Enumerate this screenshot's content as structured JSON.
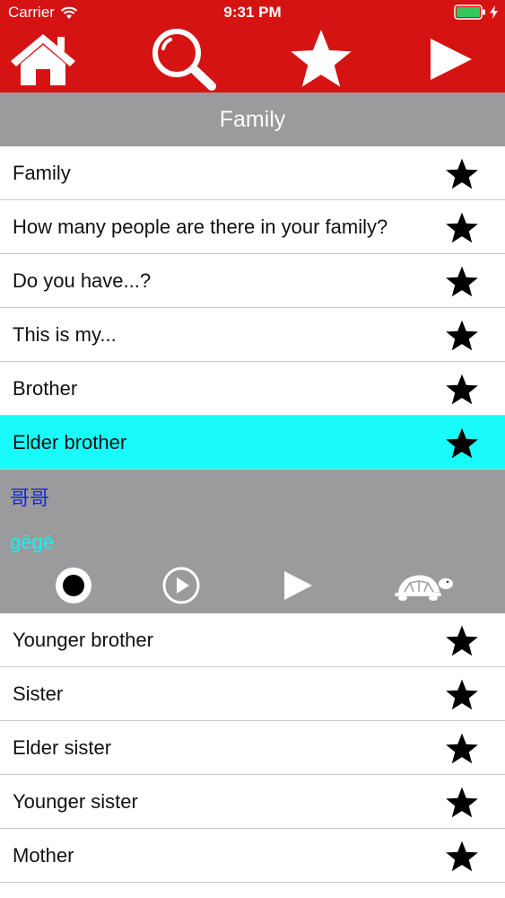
{
  "status_bar": {
    "carrier": "Carrier",
    "time": "9:31 PM",
    "wifi_icon": "wifi-icon",
    "battery_icon": "battery-icon",
    "charging_icon": "bolt-icon"
  },
  "nav": {
    "home_icon": "home-icon",
    "search_icon": "search-icon",
    "favorites_icon": "star-icon",
    "play_icon": "play-icon",
    "background_color": "#d51313"
  },
  "section": {
    "title": "Family"
  },
  "rows_top": [
    {
      "label": "Family"
    },
    {
      "label": "How many people are there in your family?"
    },
    {
      "label": "Do you have...?"
    },
    {
      "label": "This is my..."
    },
    {
      "label": "Brother"
    },
    {
      "label": "Elder brother",
      "selected": true
    }
  ],
  "detail": {
    "hanzi": "哥哥",
    "pinyin": "gēgē",
    "controls": [
      "record-icon",
      "play-circle-icon",
      "play-icon",
      "turtle-icon"
    ]
  },
  "rows_bottom": [
    {
      "label": "Younger brother"
    },
    {
      "label": "Sister"
    },
    {
      "label": "Elder sister"
    },
    {
      "label": "Younger sister"
    },
    {
      "label": "Mother"
    }
  ],
  "colors": {
    "header_red": "#d51313",
    "section_gray": "#9b9a9c",
    "selected_cyan": "#19fbfb",
    "hanzi_blue": "#1b25d6",
    "pinyin_cyan": "#14f1f4"
  }
}
